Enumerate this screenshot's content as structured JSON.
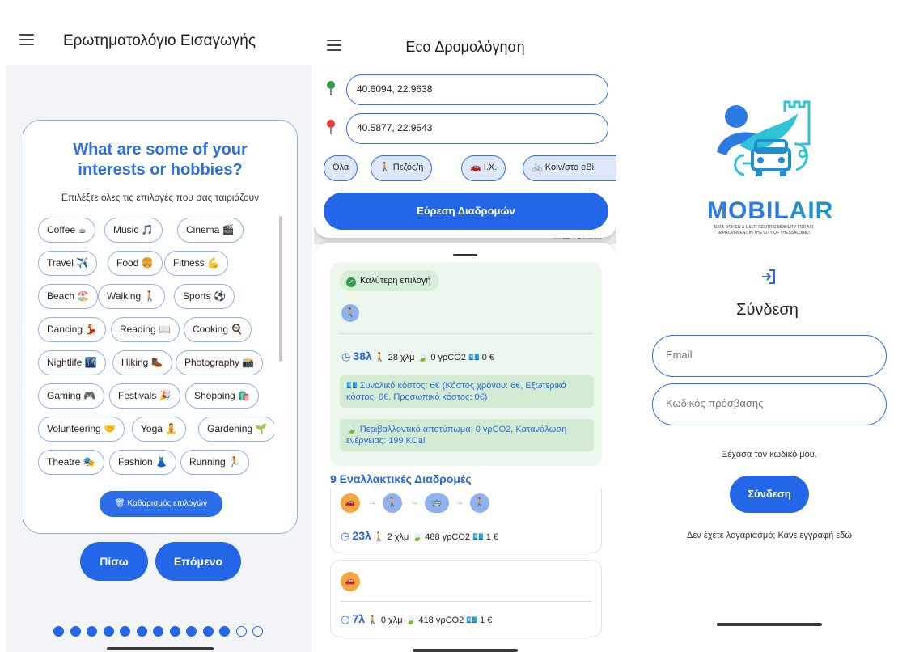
{
  "colors": {
    "primary": "#2466e8",
    "chip_border": "#8fb2ee",
    "success": "#2e9a46",
    "best_bg": "#eef7ee",
    "accent_orange": "#f4a640"
  },
  "questionnaire": {
    "title": "Ερωτηματολόγιο Εισαγωγής",
    "question_line1": "What are some of your",
    "question_line2": "interests or hobbies?",
    "subtitle": "Επιλέξτε όλες τις επιλογές που σας ταιριάζουν",
    "chips": [
      "Coffee ☕",
      "Music 🎵",
      "Cinema 🎬",
      "Travel ✈️",
      "Food 🍔",
      "Fitness 💪",
      "Beach 🏖️",
      "Walking 🚶",
      "Sports ⚽",
      "Dancing 💃",
      "Reading 📖",
      "Cooking 🍳",
      "Nightlife 🌃",
      "Hiking 🥾",
      "Photography 📸",
      "Gaming 🎮",
      "Festivals 🎉",
      "Shopping 🛍️",
      "Volunteering 🤝",
      "Yoga 🧘",
      "Gardening 🌱",
      "Theatre 🎭",
      "Fashion 👗",
      "Running 🏃"
    ],
    "clear_label": "Καθαρισμός επιλογών",
    "back_label": "Πίσω",
    "next_label": "Επόμενο",
    "steps_total": 13,
    "steps_done": 11
  },
  "routing": {
    "title": "Eco Δρομολόγηση",
    "origin": "40.6094, 22.9638",
    "destination": "40.5877, 22.9543",
    "modes": [
      "Όλα",
      "🚶 Πεζός/ή",
      "🚗 Ι.Χ.",
      "🚲 Κοιν/στο eBi"
    ],
    "find_label": "Εύρεση Διαδρομών",
    "map_label": "ΑΝΩ ΤΟΥΜΠΑ",
    "best": {
      "badge": "Καλύτερη επιλογή",
      "mode_icon": "walking-person-icon",
      "time": "38λ",
      "distance": "28 χλμ",
      "co2": "0 γρCO2",
      "cost": "0 €",
      "cost_info": "Συνολικό κόστος: 6€ (Κόστος χρόνου: 6€, Εξωτερικό κόστος: 0€, Προσωπικό κόστος: 0€)",
      "env_info": "Περιβαλλοντικό αποτύπωμα: 0 γρCO2, Κατανάλωση ενέργειας: 199 KCal"
    },
    "alternatives_heading": "9 Εναλλακτικές Διαδρομές",
    "alternatives": [
      {
        "time": "23λ",
        "distance": "2 χλμ",
        "co2": "488 γρCO2",
        "cost": "1 €"
      },
      {
        "time": "7λ",
        "distance": "0 χλμ",
        "co2": "418 γρCO2",
        "cost": "1 €"
      }
    ]
  },
  "login": {
    "logo_word_1": "MOBIL",
    "logo_word_2": "AIR",
    "logo_tagline_1": "DATA-DRIVEN & USER-CENTRIC MOBILITY FOR AIR",
    "logo_tagline_2": "IMPROVEMENT IN THE CITY OF THESSALONIKI",
    "title": "Σύνδεση",
    "email_placeholder": "Email",
    "password_placeholder": "Κωδικός πρόσβασης",
    "forgot": "Ξέχασα τον κωδικό μου.",
    "button": "Σύνδεση",
    "register": "Δεν έχετε λογαριασμό; Κάνε εγγραφή εδώ"
  }
}
